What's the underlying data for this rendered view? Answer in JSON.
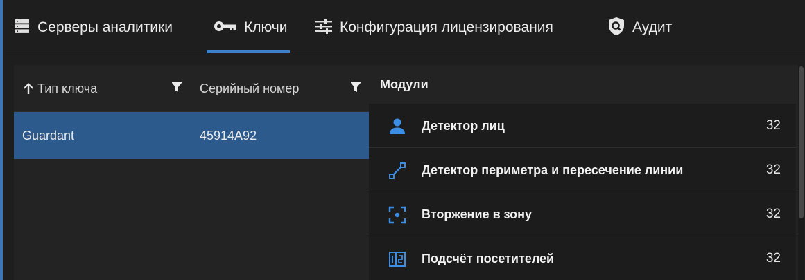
{
  "tabs": [
    {
      "label": "Серверы аналитики",
      "icon": "server-icon",
      "active": false
    },
    {
      "label": "Ключи",
      "icon": "key-icon",
      "active": true
    },
    {
      "label": "Конфигурация лицензирования",
      "icon": "sliders-icon",
      "active": false
    },
    {
      "label": "Аудит",
      "icon": "shield-search-icon",
      "active": false
    }
  ],
  "keys_table": {
    "columns": [
      {
        "label": "Тип ключа",
        "sort": "ascending"
      },
      {
        "label": "Серийный номер"
      }
    ],
    "rows": [
      {
        "type": "Guardant",
        "serial": "45914A92",
        "selected": true
      }
    ]
  },
  "modules": {
    "header": "Модули",
    "items": [
      {
        "name": "Детектор лиц",
        "count": "32",
        "icon": "person-icon"
      },
      {
        "name": "Детектор периметра и пересечение линии",
        "count": "32",
        "icon": "line-crossing-icon"
      },
      {
        "name": "Вторжение в зону",
        "count": "32",
        "icon": "zone-intrusion-icon"
      },
      {
        "name": "Подсчёт посетителей",
        "count": "32",
        "icon": "visitor-counter-icon"
      }
    ]
  },
  "colors": {
    "accent": "#3d82c8",
    "selected_row": "#2c5a8c",
    "module_icon": "#3a8ee6"
  }
}
